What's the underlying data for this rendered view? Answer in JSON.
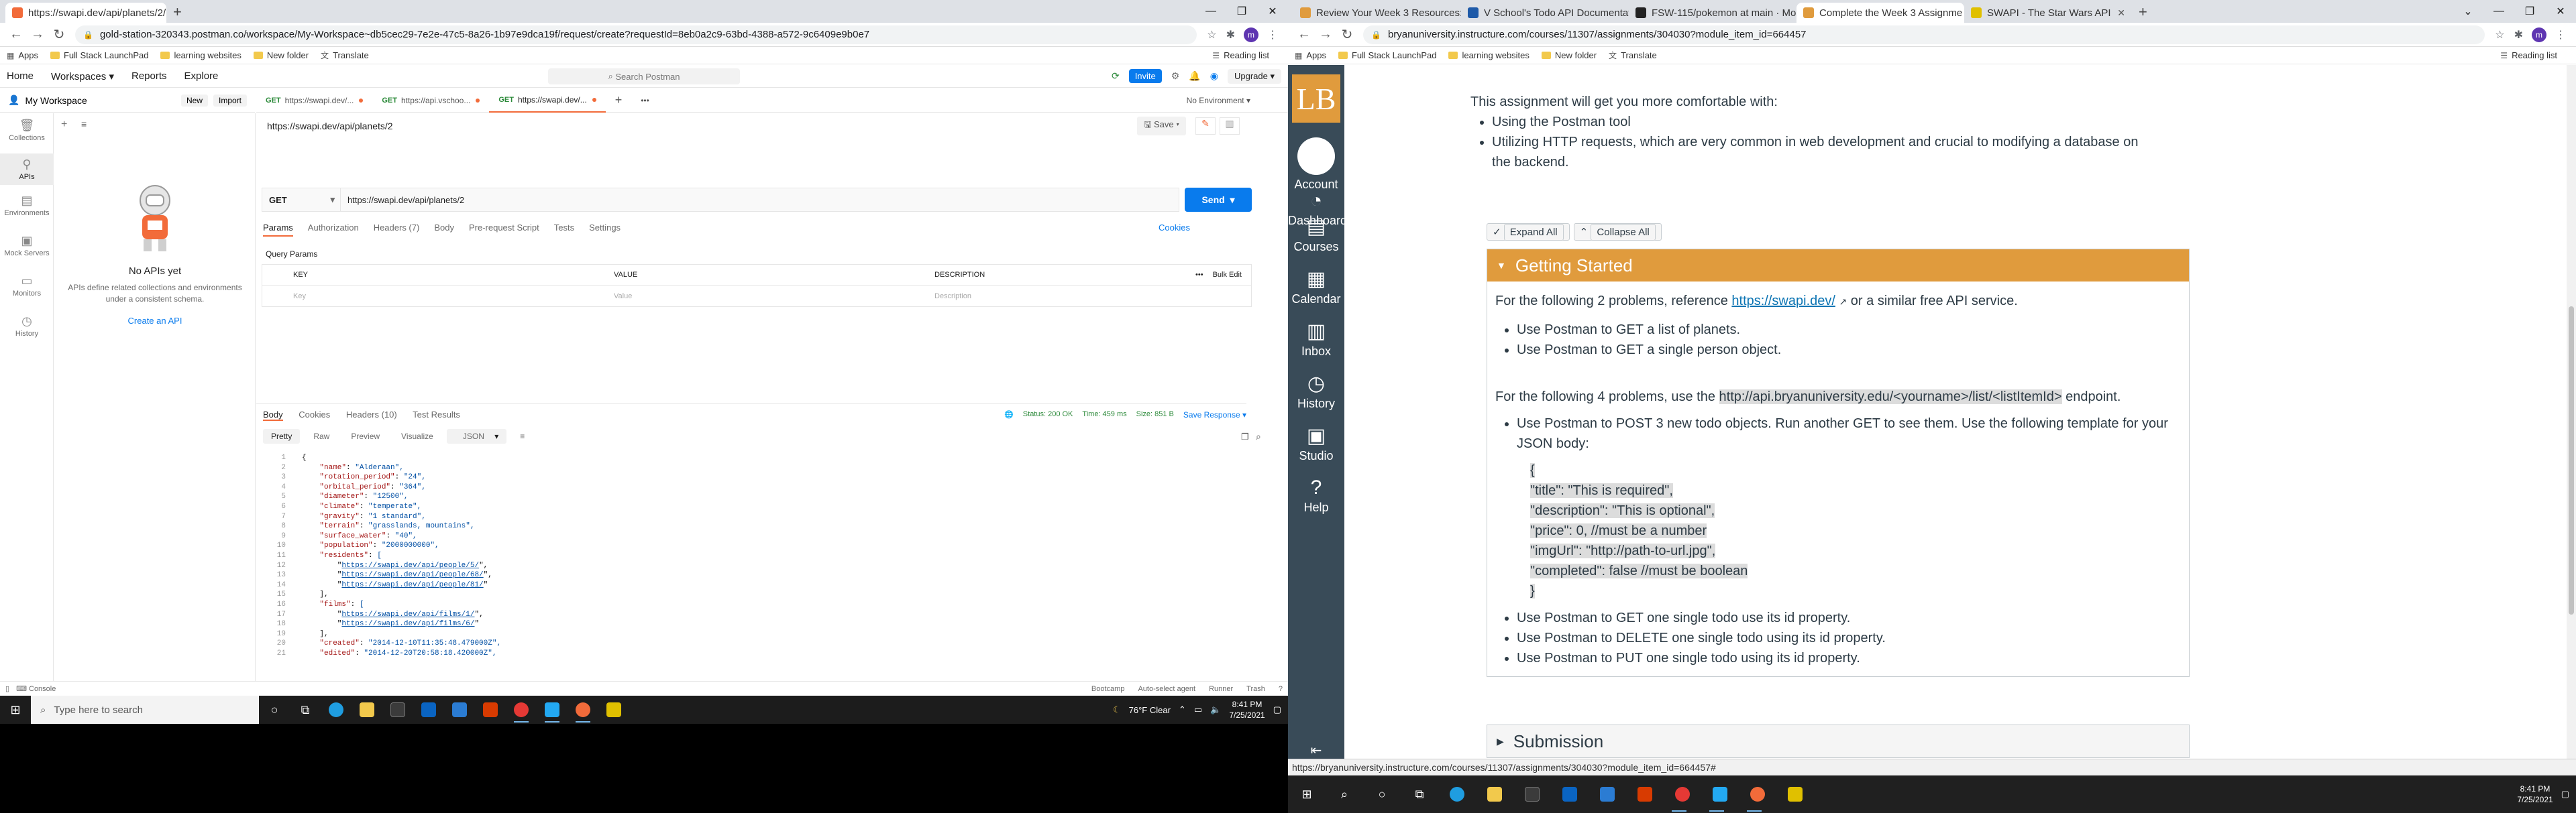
{
  "left": {
    "browser": {
      "tabs": [
        {
          "title": "https://swapi.dev/api/planets/2/",
          "color": "#f26b3a"
        }
      ],
      "url": "gold-station-320343.postman.co/workspace/My-Workspace~db5cec29-7e2e-47c5-8a26-1b97e9dca19f/request/create?requestId=8eb0a2c9-63bd-4388-a572-9c6409e9b0e7",
      "bookmarks": [
        "Apps",
        "Full Stack LaunchPad",
        "learning websites",
        "New folder",
        "Translate"
      ],
      "reading_list": "Reading list",
      "avatar": "m"
    },
    "postman": {
      "nav": [
        "Home",
        "Workspaces",
        "Reports",
        "Explore"
      ],
      "search": "Search Postman",
      "invite": "Invite",
      "upgrade": "Upgrade",
      "workspace": "My Workspace",
      "new_btn": "New",
      "import_btn": "Import",
      "rail": [
        "Collections",
        "APIs",
        "Environments",
        "Mock Servers",
        "Monitors",
        "History"
      ],
      "empty_title": "No APIs yet",
      "empty_desc": "APIs define related collections and environments under a consistent schema.",
      "empty_link": "Create an API",
      "request_tabs": [
        {
          "method": "GET",
          "label": "https://swapi.dev/..."
        },
        {
          "method": "GET",
          "label": "https://api.vschoo..."
        },
        {
          "method": "GET",
          "label": "https://swapi.dev/..."
        }
      ],
      "environment": "No Environment",
      "request_name": "https://swapi.dev/api/planets/2",
      "save": "Save",
      "method": "GET",
      "request_url": "https://swapi.dev/api/planets/2",
      "send": "Send",
      "sub_tabs": [
        "Params",
        "Authorization",
        "Headers (7)",
        "Body",
        "Pre-request Script",
        "Tests",
        "Settings"
      ],
      "cookies": "Cookies",
      "query_params": "Query Params",
      "param_headers": [
        "KEY",
        "VALUE",
        "DESCRIPTION"
      ],
      "bulk_edit": "Bulk Edit",
      "param_placeholders": [
        "Key",
        "Value",
        "Description"
      ],
      "response_tabs": [
        "Body",
        "Cookies",
        "Headers (10)",
        "Test Results"
      ],
      "status": "Status: 200 OK",
      "time": "Time: 459 ms",
      "size": "Size: 851 B",
      "save_response": "Save Response",
      "format_tabs": [
        "Pretty",
        "Raw",
        "Preview",
        "Visualize"
      ],
      "format": "JSON",
      "code_lines": [
        {
          "n": "1",
          "t": "{"
        },
        {
          "n": "2",
          "t": "    \"name\": \"Alderaan\","
        },
        {
          "n": "3",
          "t": "    \"rotation_period\": \"24\","
        },
        {
          "n": "4",
          "t": "    \"orbital_period\": \"364\","
        },
        {
          "n": "5",
          "t": "    \"diameter\": \"12500\","
        },
        {
          "n": "6",
          "t": "    \"climate\": \"temperate\","
        },
        {
          "n": "7",
          "t": "    \"gravity\": \"1 standard\","
        },
        {
          "n": "8",
          "t": "    \"terrain\": \"grasslands, mountains\","
        },
        {
          "n": "9",
          "t": "    \"surface_water\": \"40\","
        },
        {
          "n": "10",
          "t": "    \"population\": \"2000000000\","
        },
        {
          "n": "11",
          "t": "    \"residents\": ["
        },
        {
          "n": "12",
          "t": "        \"https://swapi.dev/api/people/5/\","
        },
        {
          "n": "13",
          "t": "        \"https://swapi.dev/api/people/68/\","
        },
        {
          "n": "14",
          "t": "        \"https://swapi.dev/api/people/81/\""
        },
        {
          "n": "15",
          "t": "    ],"
        },
        {
          "n": "16",
          "t": "    \"films\": ["
        },
        {
          "n": "17",
          "t": "        \"https://swapi.dev/api/films/1/\","
        },
        {
          "n": "18",
          "t": "        \"https://swapi.dev/api/films/6/\""
        },
        {
          "n": "19",
          "t": "    ],"
        },
        {
          "n": "20",
          "t": "    \"created\": \"2014-12-10T11:35:48.479000Z\","
        },
        {
          "n": "21",
          "t": "    \"edited\": \"2014-12-20T20:58:18.420000Z\","
        }
      ],
      "footer_left": "Console",
      "footer_right": [
        "Bootcamp",
        "Auto-select agent",
        "Runner",
        "Trash"
      ]
    },
    "taskbar": {
      "search": "Type here to search",
      "weather": "76°F  Clear",
      "time": "8:41 PM",
      "date": "7/25/2021"
    }
  },
  "right": {
    "browser": {
      "tabs": [
        {
          "title": "Review Your Week 3 Resources: F",
          "color": "#e09b3d"
        },
        {
          "title": "V School's Todo API Documentat",
          "color": "#1e5aa8"
        },
        {
          "title": "FSW-115/pokemon at main · Mo",
          "color": "#222222"
        },
        {
          "title": "Complete the Week 3 Assignme",
          "color": "#e09b3d"
        },
        {
          "title": "SWAPI - The Star Wars API",
          "color": "#e0c000"
        }
      ],
      "url": "bryanuniversity.instructure.com/courses/11307/assignments/304030?module_item_id=664457",
      "bookmarks": [
        "Apps",
        "Full Stack LaunchPad",
        "learning websites",
        "New folder",
        "Translate"
      ],
      "reading_list": "Reading list",
      "avatar": "m"
    },
    "canvas": {
      "logo": "LB",
      "nav": [
        "Account",
        "Dashboard",
        "Courses",
        "Calendar",
        "Inbox",
        "History",
        "Studio",
        "Help"
      ],
      "intro": "This assignment will get you more comfortable with:",
      "intro_items": [
        "Using the Postman tool",
        "Utilizing HTTP requests, which are very common in web development and crucial to modifying a database on the backend."
      ],
      "expand_all": "Expand All",
      "collapse_all": "Collapse All",
      "section1": "Getting Started",
      "p1_before": "For the following 2 problems, reference",
      "p1_link": "https://swapi.dev/",
      "p1_after": "or a similar free API service.",
      "list1": [
        "Use Postman to GET a list of planets.",
        "Use Postman to GET a single person object."
      ],
      "p2_before": "For the following 4 problems, use the",
      "p2_code": "http://api.bryanuniversity.edu/<yourname>/list/<listItemId>",
      "p2_after": "endpoint.",
      "list2_first": "Use Postman to POST 3 new todo objects. Run another GET to see them. Use the following template for your JSON body:",
      "template": [
        "{",
        " \"title\": \"This is required\",",
        " \"description\": \"This is optional\",",
        " \"price\": 0, //must be a number",
        " \"imgUrl\": \"http://path-to-url.jpg\",",
        " \"completed\": false //must be boolean",
        "}"
      ],
      "list3": [
        "Use Postman to GET one single todo use its id property.",
        "Use Postman to DELETE one single todo using its id property.",
        "Use Postman to PUT one single todo using its id property."
      ],
      "section2": "Submission",
      "status_url": "https://bryanuniversity.instructure.com/courses/11307/assignments/304030?module_item_id=664457#"
    },
    "taskbar": {
      "time": "8:41 PM",
      "date": "7/25/2021"
    }
  }
}
